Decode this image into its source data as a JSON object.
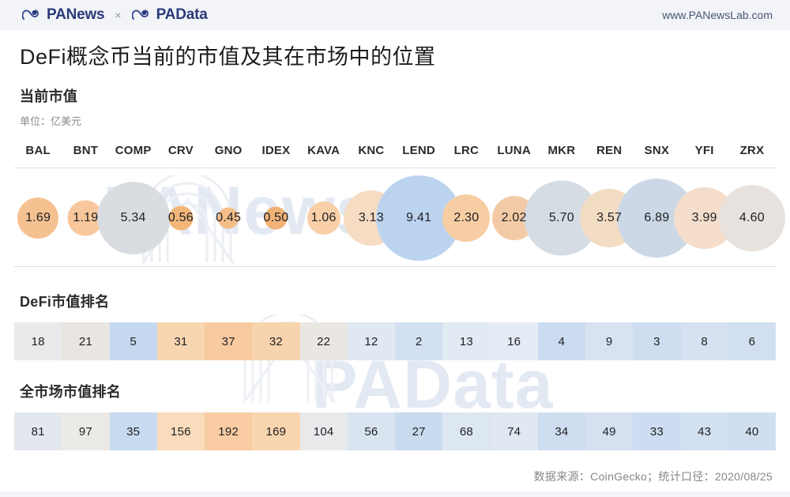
{
  "header": {
    "brand_primary": "PANews",
    "brand_separator": "×",
    "brand_secondary": "PAData",
    "site_url": "www.PANewsLab.com"
  },
  "title": "DeFi概念币当前的市值及其在市场中的位置",
  "sections": {
    "market_cap_label": "当前市值",
    "market_cap_unit": "单位：亿美元",
    "defi_rank_label": "DeFi市值排名",
    "global_rank_label": "全市场市值排名"
  },
  "watermarks": {
    "top": "PANews",
    "bottom": "PAData"
  },
  "footer": {
    "source": "数据来源：CoinGecko；统计口径：2020/08/25"
  },
  "colors": {
    "orange": "#f5c08f",
    "orange_light": "#fadcc0",
    "blue": "#b9d1ee",
    "blue_light": "#d7e3f2",
    "grey": "#e2e4e6",
    "grey_warm": "#e8e3de",
    "header_bg": "#f2f4f7",
    "brand_navy": "#2b3a7a"
  },
  "chart_data": {
    "type": "bar",
    "title": "DeFi概念币当前的市值及其在市场中的位置",
    "subtitle": "当前市值",
    "ylabel": "单位：亿美元",
    "categories": [
      "BAL",
      "BNT",
      "COMP",
      "CRV",
      "GNO",
      "IDEX",
      "KAVA",
      "KNC",
      "LEND",
      "LRC",
      "LUNA",
      "MKR",
      "REN",
      "SNX",
      "YFI",
      "ZRX"
    ],
    "series": [
      {
        "name": "当前市值",
        "unit": "亿美元",
        "values": [
          1.69,
          1.19,
          5.34,
          0.56,
          0.45,
          0.5,
          1.06,
          3.13,
          9.41,
          2.3,
          2.02,
          5.7,
          3.57,
          6.89,
          3.99,
          4.6
        ]
      },
      {
        "name": "DeFi市值排名",
        "values": [
          18,
          21,
          5,
          31,
          37,
          32,
          22,
          12,
          2,
          13,
          16,
          4,
          9,
          3,
          8,
          6
        ]
      },
      {
        "name": "全市场市值排名",
        "values": [
          81,
          97,
          35,
          156,
          192,
          169,
          104,
          56,
          27,
          68,
          74,
          34,
          49,
          33,
          43,
          40
        ]
      }
    ],
    "legend_position": "none",
    "grid": false
  },
  "bubbles": [
    {
      "ticker": "BAL",
      "value": "1.69",
      "size": 52,
      "color": "#f6c191"
    },
    {
      "ticker": "BNT",
      "value": "1.19",
      "size": 45,
      "color": "#f8c79b"
    },
    {
      "ticker": "COMP",
      "value": "5.34",
      "size": 92,
      "color": "#d9dde1"
    },
    {
      "ticker": "CRV",
      "value": "0.56",
      "size": 31,
      "color": "#f3b679"
    },
    {
      "ticker": "GNO",
      "value": "0.45",
      "size": 27,
      "color": "#f5be89"
    },
    {
      "ticker": "IDEX",
      "value": "0.50",
      "size": 29,
      "color": "#f2b277"
    },
    {
      "ticker": "KAVA",
      "value": "1.06",
      "size": 42,
      "color": "#f9cfa8"
    },
    {
      "ticker": "KNC",
      "value": "3.13",
      "size": 70,
      "color": "#f6dcc2"
    },
    {
      "ticker": "LEND",
      "value": "9.41",
      "size": 108,
      "color": "#bcd3ef"
    },
    {
      "ticker": "LRC",
      "value": "2.30",
      "size": 60,
      "color": "#f7cda3"
    },
    {
      "ticker": "LUNA",
      "value": "2.02",
      "size": 56,
      "color": "#f2cba6"
    },
    {
      "ticker": "MKR",
      "value": "5.70",
      "size": 95,
      "color": "#d5dce4"
    },
    {
      "ticker": "REN",
      "value": "3.57",
      "size": 74,
      "color": "#f3dcc4"
    },
    {
      "ticker": "SNX",
      "value": "6.89",
      "size": 100,
      "color": "#ccd8e6"
    },
    {
      "ticker": "YFI",
      "value": "3.99",
      "size": 78,
      "color": "#f4ddcb"
    },
    {
      "ticker": "ZRX",
      "value": "4.60",
      "size": 84,
      "color": "#e7e2dd"
    }
  ],
  "defi_rank_cells": [
    {
      "value": "18",
      "bg": "#eaeaec"
    },
    {
      "value": "21",
      "bg": "#e9e5e0"
    },
    {
      "value": "5",
      "bg": "#c4d9f0"
    },
    {
      "value": "31",
      "bg": "#f8d6b2"
    },
    {
      "value": "37",
      "bg": "#f8caa0"
    },
    {
      "value": "32",
      "bg": "#f7d4ae"
    },
    {
      "value": "22",
      "bg": "#eae7e3"
    },
    {
      "value": "12",
      "bg": "#dfe8f3"
    },
    {
      "value": "2",
      "bg": "#d2e0f1"
    },
    {
      "value": "13",
      "bg": "#e2eaf4"
    },
    {
      "value": "16",
      "bg": "#e4ebf4"
    },
    {
      "value": "4",
      "bg": "#ccdcf0"
    },
    {
      "value": "9",
      "bg": "#d8e3f2"
    },
    {
      "value": "3",
      "bg": "#cedef0"
    },
    {
      "value": "8",
      "bg": "#d6e2f1"
    },
    {
      "value": "6",
      "bg": "#d1dff0"
    }
  ],
  "global_rank_cells": [
    {
      "value": "81",
      "bg": "#e3e8ee"
    },
    {
      "value": "97",
      "bg": "#eceae7"
    },
    {
      "value": "35",
      "bg": "#c7daef"
    },
    {
      "value": "156",
      "bg": "#fadcbc"
    },
    {
      "value": "192",
      "bg": "#f9cca3"
    },
    {
      "value": "169",
      "bg": "#f9d5b0"
    },
    {
      "value": "104",
      "bg": "#e8eaec"
    },
    {
      "value": "56",
      "bg": "#d9e4f1"
    },
    {
      "value": "27",
      "bg": "#c9dbef"
    },
    {
      "value": "68",
      "bg": "#dde7f2"
    },
    {
      "value": "74",
      "bg": "#e0e8f2"
    },
    {
      "value": "34",
      "bg": "#cfddf0"
    },
    {
      "value": "49",
      "bg": "#d5e1f1"
    },
    {
      "value": "33",
      "bg": "#cddcf0"
    },
    {
      "value": "43",
      "bg": "#d3e0f1"
    },
    {
      "value": "40",
      "bg": "#d0def0"
    }
  ]
}
